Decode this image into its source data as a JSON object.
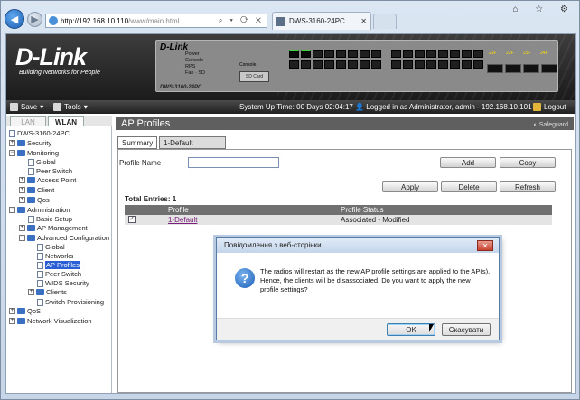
{
  "browser": {
    "url_host": "http://192.168.10.110",
    "url_path": "/www/main.html",
    "address_icons": "⌕ ▾ ⟳ ✕",
    "tab_title": "DWS-3160-24PC",
    "window_icons": "⌂ ☆ ⚙"
  },
  "banner": {
    "logo": "D-Link",
    "tagline": "Building Networks for People",
    "device_logo": "D-Link",
    "device_model": "DWS-3160-24PC",
    "led_labels": "Power\nConsole\nRPS\nFan\nSD",
    "link_labels": "Link   Mono",
    "console_label": "Console",
    "sd_label": "SD Card",
    "port_labels_top": "1 2 3 4 5 6 7 8 9 10 11 12 13 14 15 16 17 18 19 20 21T 22T 23T 24T",
    "sfp_labels": [
      "21F",
      "22F",
      "23F",
      "24F"
    ]
  },
  "toolbar": {
    "save": "Save",
    "tools": "Tools",
    "status": "System Up Time: 00 Days 02:04:17",
    "login": "Logged in as Administrator, admin - 192.168.10.101",
    "logout": "Logout"
  },
  "left_tabs": {
    "lan": "LAN",
    "wlan": "WLAN"
  },
  "tree": {
    "root": "DWS-3160-24PC",
    "security": "Security",
    "monitoring": "Monitoring",
    "mon_global": "Global",
    "mon_peer": "Peer Switch",
    "mon_ap": "Access Point",
    "mon_client": "Client",
    "mon_qos": "Qos",
    "administration": "Administration",
    "basic_setup": "Basic Setup",
    "ap_mgmt": "AP Management",
    "adv_config": "Advanced Configuration",
    "adv_global": "Global",
    "adv_networks": "Networks",
    "adv_ap_profiles": "AP Profiles",
    "adv_peer": "Peer Switch",
    "adv_wids": "WIDS Security",
    "adv_clients": "Clients",
    "adv_switch_prov": "Switch Provisioning",
    "qos": "QoS",
    "net_vis": "Network Visualization"
  },
  "content": {
    "title": "AP Profiles",
    "safeguard": "Safeguard",
    "tab_summary": "Summary",
    "tab_default": "1-Default",
    "profile_name_label": "Profile Name",
    "profile_name_value": "",
    "btn_add": "Add",
    "btn_copy": "Copy",
    "btn_apply": "Apply",
    "btn_delete": "Delete",
    "btn_refresh": "Refresh",
    "total_entries": "Total Entries: 1",
    "col_profile": "Profile",
    "col_status": "Profile Status",
    "rows": [
      {
        "checked": "✓",
        "profile": "1-Default",
        "status": "Associated - Modified"
      }
    ]
  },
  "dialog": {
    "title": "Повідомлення з веб-сторінки",
    "close": "✕",
    "message": "The radios will restart as the new AP profile settings are applied to the AP(s). Hence, the clients will be disassociated. Do you want to apply the new profile settings?",
    "ok": "OK",
    "cancel": "Скасувати"
  }
}
